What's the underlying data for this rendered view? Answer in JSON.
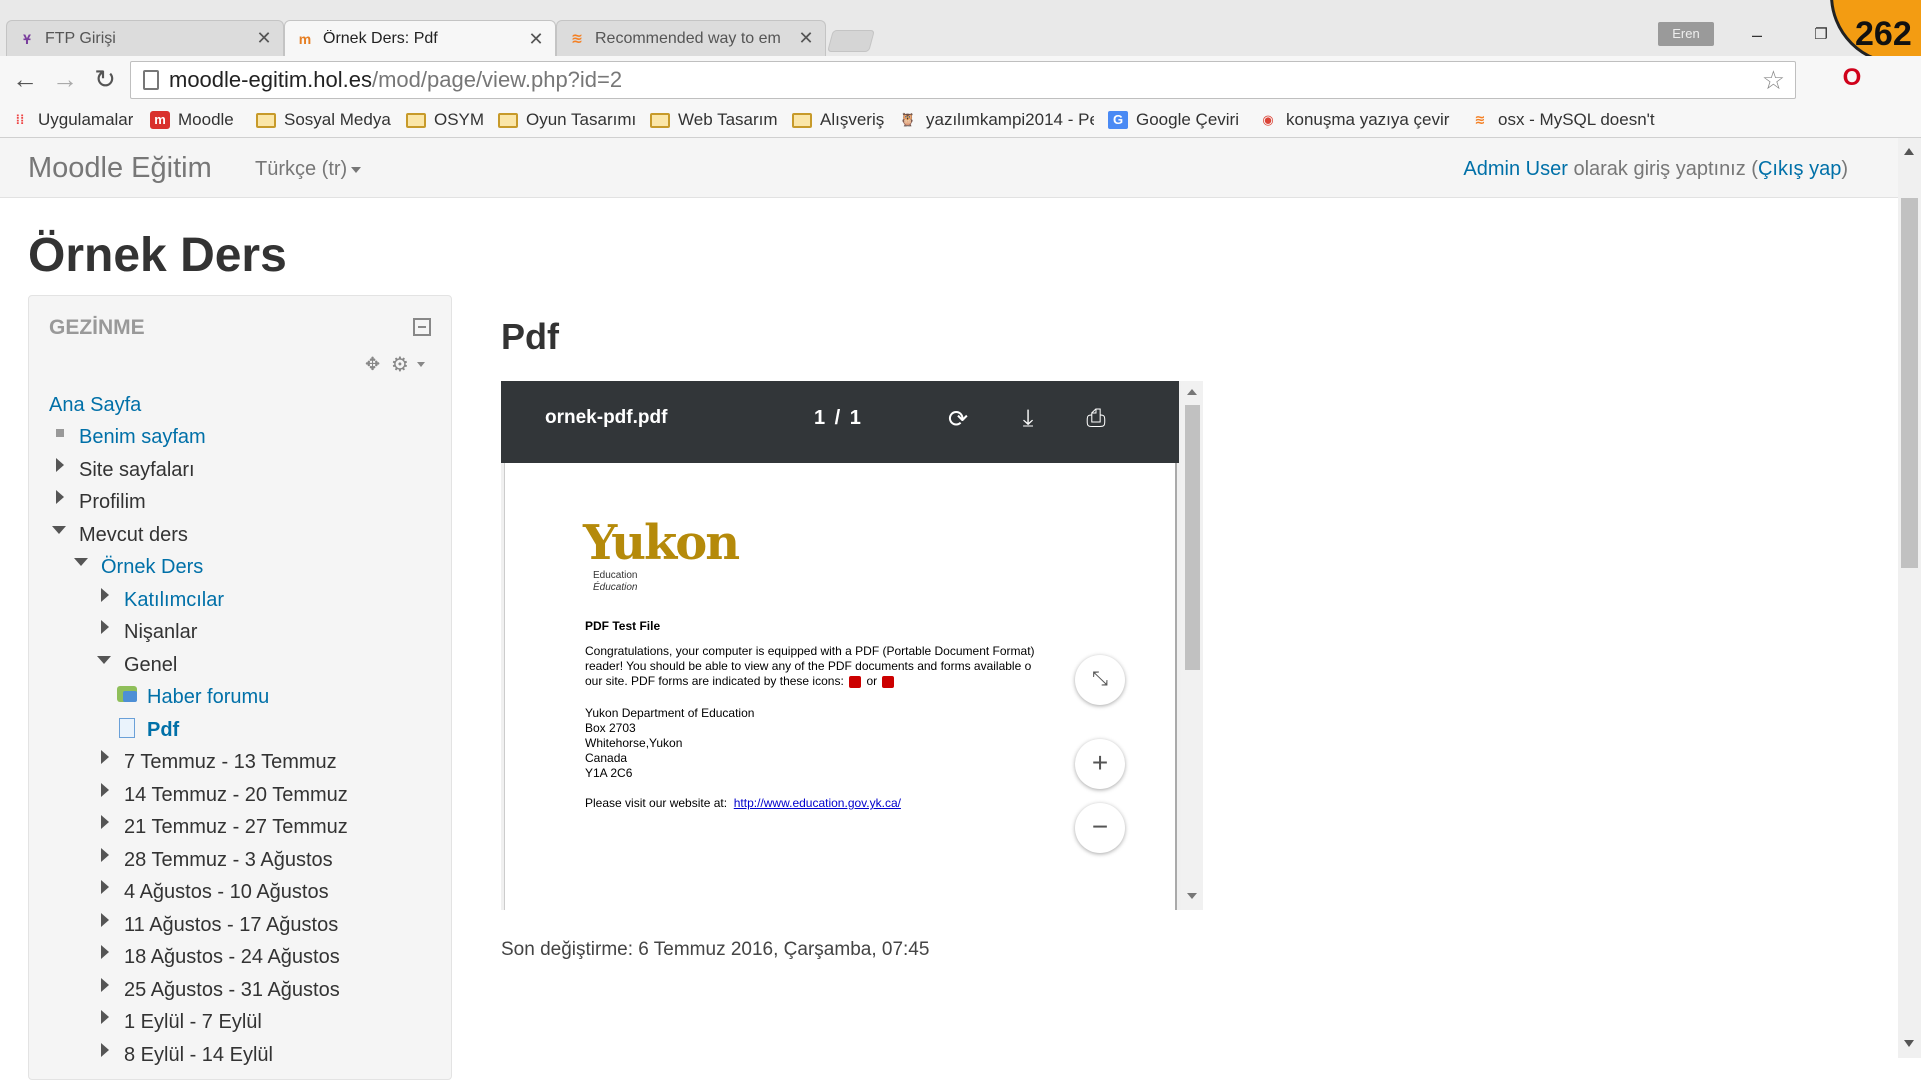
{
  "browser": {
    "tabs": [
      {
        "title": "FTP Girişi",
        "favicon": "ftp-icon"
      },
      {
        "title": "Örnek Ders: Pdf",
        "favicon": "moodle-icon"
      },
      {
        "title": "Recommended way to em",
        "favicon": "stackoverflow-icon"
      }
    ],
    "profile": "Eren",
    "recording_badge": "262",
    "url_host": "moodle-egitim.hol.es",
    "url_path": "/mod/page/view.php?id=2",
    "bookmarks": [
      "Uygulamalar",
      "Moodle",
      "Sosyal Medya",
      "OSYM",
      "Oyun Tasarımı",
      "Web Tasarım",
      "Alışveriş",
      "yazılımkampi2014 - Pe",
      "Google Çeviri",
      "konuşma yazıya çevir",
      "osx - MySQL doesn't s"
    ]
  },
  "navbar": {
    "brand": "Moodle Eğitim",
    "language": "Türkçe (tr)",
    "login_user": "Admin User",
    "login_text": " olarak giriş yaptınız (",
    "logout": "Çıkış yap",
    "login_close": ")"
  },
  "course": {
    "title": "Örnek Ders"
  },
  "navigation_block": {
    "header": "GEZİNME",
    "items": [
      "Ana Sayfa",
      "Benim sayfam",
      "Site sayfaları",
      "Profilim",
      "Mevcut ders",
      "Örnek Ders",
      "Katılımcılar",
      "Nişanlar",
      "Genel",
      "Haber forumu",
      "Pdf",
      "7 Temmuz - 13 Temmuz",
      "14 Temmuz - 20 Temmuz",
      "21 Temmuz - 27 Temmuz",
      "28 Temmuz - 3 Ağustos",
      "4 Ağustos - 10 Ağustos",
      "11 Ağustos - 17 Ağustos",
      "18 Ağustos - 24 Ağustos",
      "25 Ağustos - 31 Ağustos",
      "1 Eylül - 7 Eylül",
      "8 Eylül - 14 Eylül"
    ]
  },
  "main": {
    "title": "Pdf",
    "last_modified": "Son değiştirme: 6 Temmuz 2016, Çarşamba, 07:45"
  },
  "pdf_viewer": {
    "filename": "ornek-pdf.pdf",
    "page_indicator": "1 / 1",
    "logo_word": "Yukon",
    "logo_sub1": "Education",
    "logo_sub2": "Éducation",
    "heading": "PDF Test File",
    "para_line1": "Congratulations, your computer is equipped with a PDF (Portable Document Format)",
    "para_line2": "reader!  You should be able to view any of the PDF documents and forms available o",
    "para_line3a": "our site.  PDF forms are indicated by these icons:",
    "para_line3b": "or",
    "address": [
      "Yukon Department of Education",
      "Box 2703",
      "Whitehorse,Yukon",
      "Canada",
      "Y1A 2C6"
    ],
    "visit_text": "Please visit our website at:",
    "website": "http://www.education.gov.yk.ca/"
  }
}
